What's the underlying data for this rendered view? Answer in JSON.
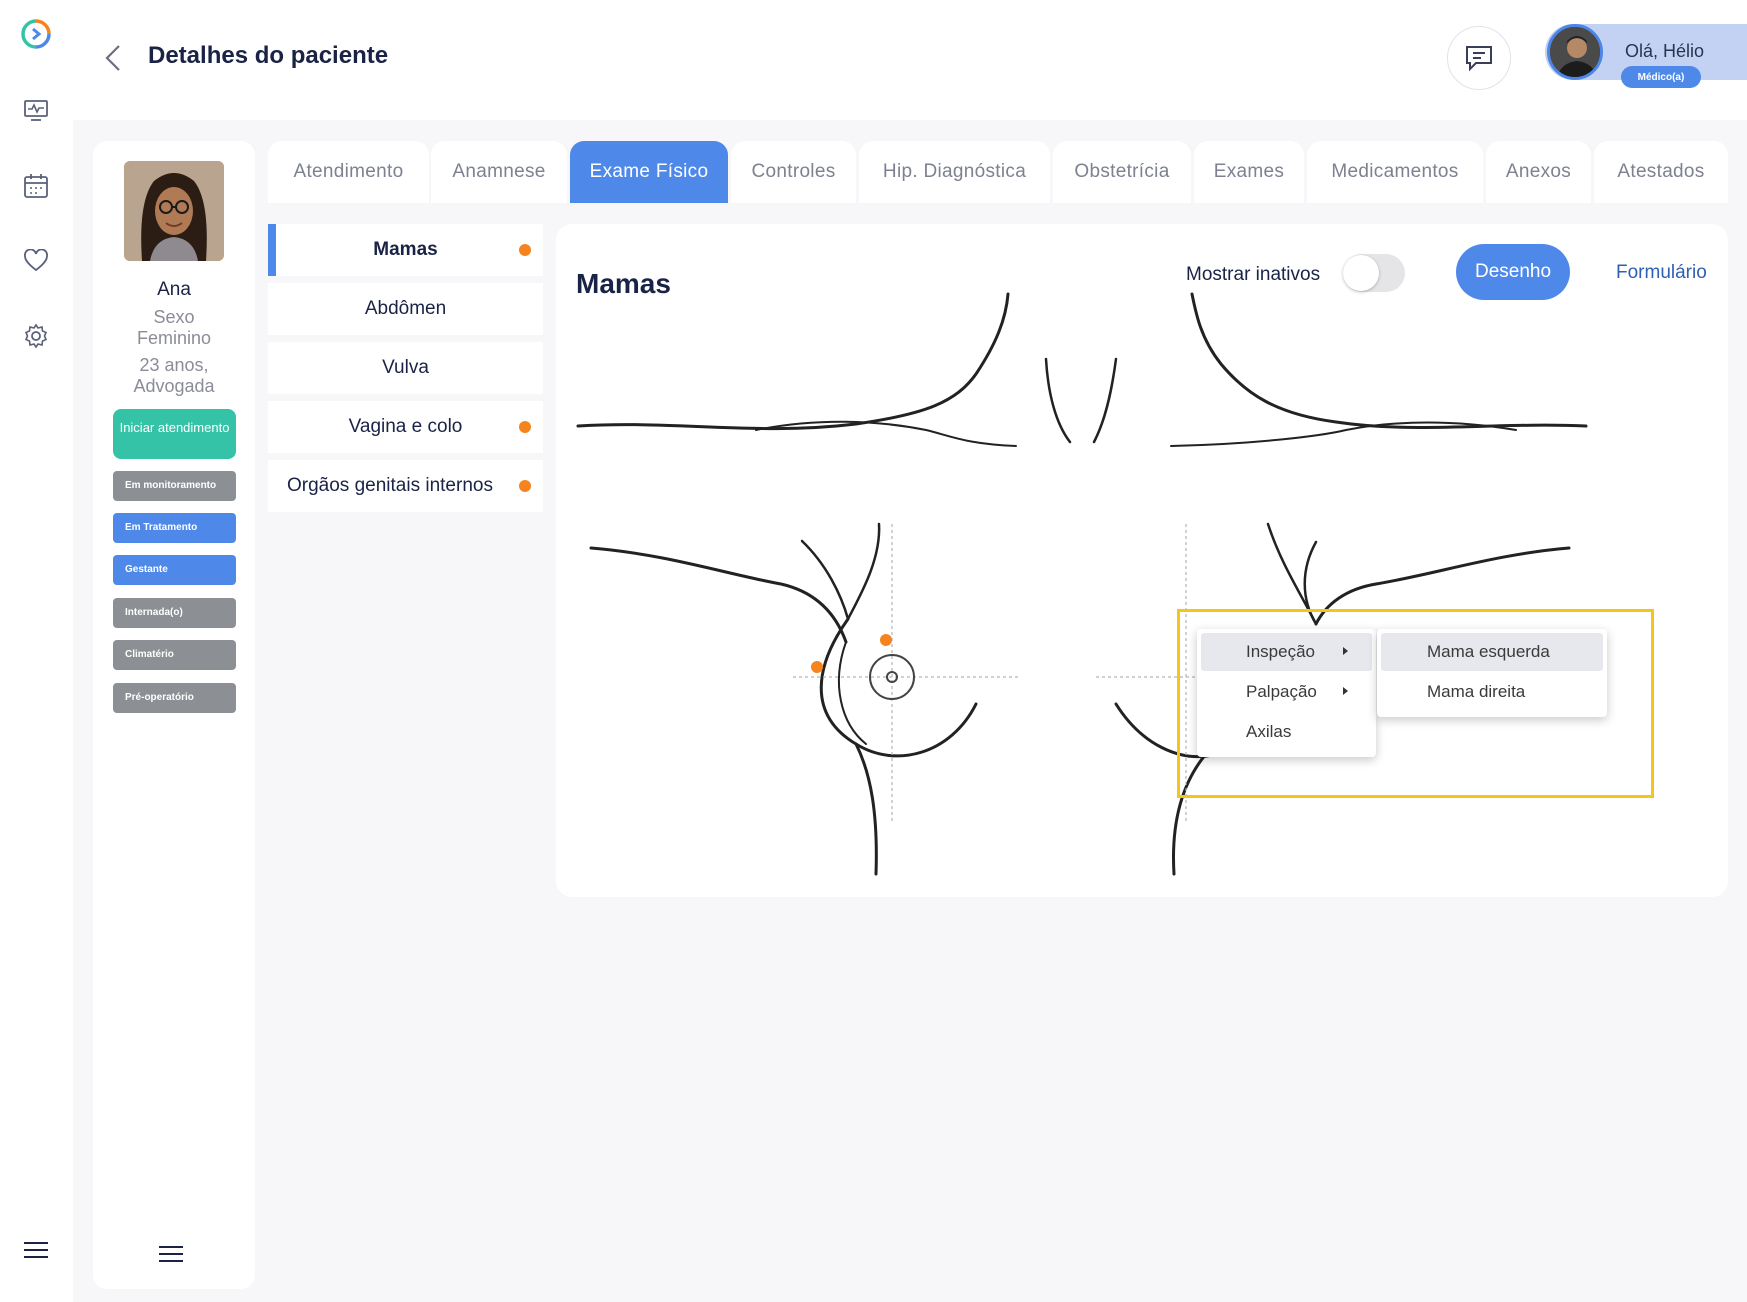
{
  "header": {
    "title": "Detalhes do paciente",
    "greeting": "Olá, Hélio",
    "role": "Médico(a)"
  },
  "rail": {
    "icons": [
      "logo-icon",
      "monitor-icon",
      "calendar-icon",
      "heart-icon",
      "gear-icon",
      "menu-icon"
    ]
  },
  "patient": {
    "name": "Ana",
    "sex_line1": "Sexo",
    "sex_line2": "Feminino",
    "age_line": "23 anos,",
    "occupation": "Advogada",
    "start_button": "Iniciar atendimento",
    "tags": [
      "Em monitoramento",
      "Em Tratamento",
      "Gestante",
      "Internada(o)",
      "Climatério",
      "Pré-operatório"
    ]
  },
  "tabs": [
    "Atendimento",
    "Anamnese",
    "Exame Físico",
    "Controles",
    "Hip. Diagnóstica",
    "Obstetrícia",
    "Exames",
    "Medicamentos",
    "Anexos",
    "Atestados"
  ],
  "active_tab": "Exame Físico",
  "subnav": [
    "Mamas",
    "Abdômen",
    "Vulva",
    "Vagina e colo",
    "Orgãos genitais internos"
  ],
  "panel": {
    "title": "Mamas",
    "toggle_label": "Mostrar inativos",
    "view_drawing": "Desenho",
    "view_form": "Formulário"
  },
  "context_menu": {
    "items": [
      "Inspeção",
      "Palpação",
      "Axilas"
    ],
    "submenu": [
      "Mama esquerda",
      "Mama direita"
    ]
  },
  "colors": {
    "primary": "#4e89ea",
    "accent_green": "#35c3a7",
    "marker_orange": "#f5841f",
    "highlight_yellow": "#f5c518"
  }
}
